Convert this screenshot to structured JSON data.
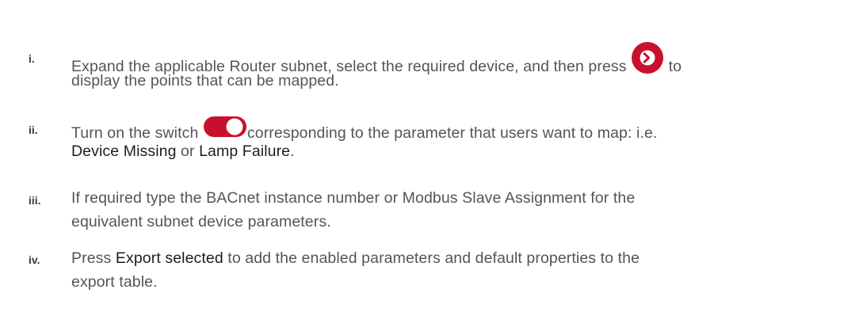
{
  "steps": [
    {
      "number": "i.",
      "line1_before_icon": "Expand the applicable Router subnet, select the required device, and then press ",
      "line1_after_icon": " to",
      "line2": "display the points that can be mapped."
    },
    {
      "number": "ii.",
      "line1_before_icon": "Turn on the switch ",
      "line1_after_icon": "corresponding to the parameter that users want to map: i.e.",
      "line2_term1": "Device Missing",
      "line2_connector": " or ",
      "line2_term2": "Lamp Failure",
      "line2_end": "."
    },
    {
      "number": "iii.",
      "line1": "If required type the BACnet instance number or Modbus Slave Assignment for the",
      "line2": "equivalent subnet device parameters."
    },
    {
      "number": "iv.",
      "line1_before_term": "Press ",
      "line1_term": "Export selected",
      "line1_after_term": " to add the enabled parameters and default properties to the",
      "line2": "export table."
    }
  ],
  "icons": {
    "next_button": "chevron-right-circle-icon",
    "toggle_switch": "toggle-switch-on-icon",
    "accent_color": "#c8102e"
  }
}
